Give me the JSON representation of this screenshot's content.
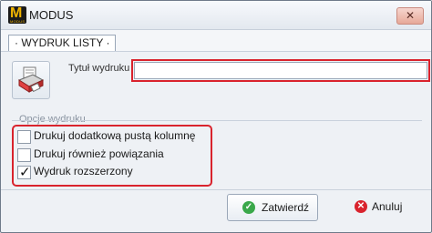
{
  "window": {
    "title": "MODUS",
    "logo_letter": "M",
    "logo_sub": "MODUS",
    "close_glyph": "✕"
  },
  "tab": {
    "label": "· WYDRUK LISTY ·"
  },
  "form": {
    "title_label": "Tytuł wydruku",
    "title_value": "",
    "title_placeholder": ""
  },
  "options": {
    "group_label": "Opcje wydruku",
    "items": [
      {
        "label": "Drukuj dodatkową pustą kolumnę",
        "checked": false
      },
      {
        "label": "Drukuj również powiązania",
        "checked": false
      },
      {
        "label": "Wydruk rozszerzony",
        "checked": true
      }
    ]
  },
  "buttons": {
    "confirm_label": "Zatwierdź",
    "cancel_label": "Anuluj"
  },
  "colors": {
    "highlight": "#d9232d",
    "confirm_icon": "#3aa84a",
    "cancel_icon": "#d9232d"
  },
  "icons": {
    "printer": "printer-icon",
    "confirm": "check-circle-icon",
    "cancel": "x-circle-icon",
    "close": "close-icon"
  }
}
